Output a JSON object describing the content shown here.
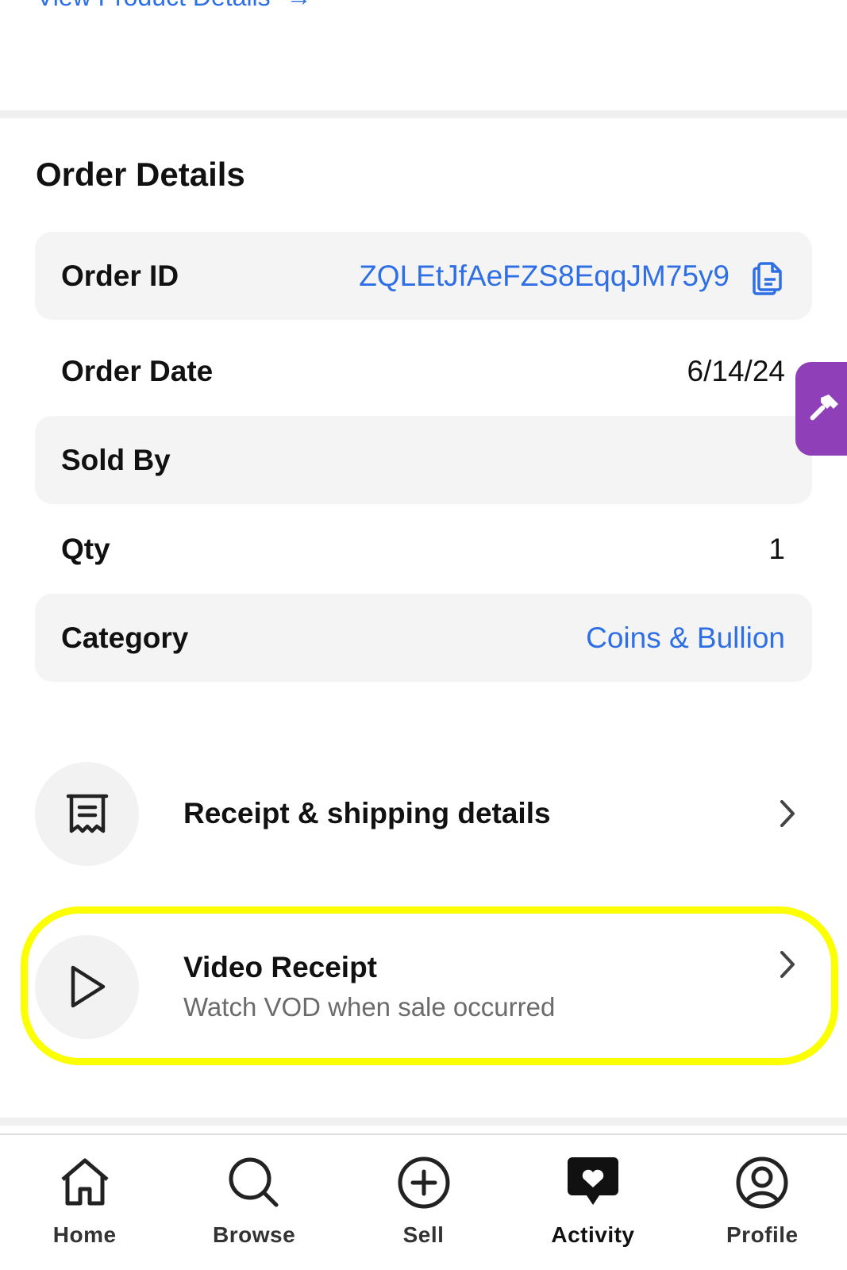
{
  "top_link": {
    "label": "View Product Details",
    "arrow": "→"
  },
  "order_details": {
    "title": "Order Details",
    "rows": [
      {
        "label": "Order ID",
        "value": "ZQLEtJfAeFZS8EqqJM75y9"
      },
      {
        "label": "Order Date",
        "value": "6/14/24"
      },
      {
        "label": "Sold By",
        "value": ""
      },
      {
        "label": "Qty",
        "value": "1"
      },
      {
        "label": "Category",
        "value": "Coins & Bullion"
      }
    ]
  },
  "actions": {
    "receipt": {
      "title": "Receipt & shipping details"
    },
    "video": {
      "title": "Video Receipt",
      "subtitle": "Watch VOD when sale occurred"
    }
  },
  "nav": {
    "items": [
      {
        "label": "Home",
        "icon": "home-icon"
      },
      {
        "label": "Browse",
        "icon": "search-icon"
      },
      {
        "label": "Sell",
        "icon": "plus-circle-icon"
      },
      {
        "label": "Activity",
        "icon": "heart-chat-icon",
        "active": true
      },
      {
        "label": "Profile",
        "icon": "user-circle-icon"
      }
    ]
  },
  "colors": {
    "link": "#2f6fe6",
    "highlight": "#fbff00",
    "side_tab": "#8f3fb8",
    "row_shade": "#f4f4f4"
  },
  "icons": {
    "copy": "copy-icon",
    "side_tab": "hammer-icon",
    "receipt": "receipt-icon",
    "video": "play-icon",
    "chevron": "chevron-right-icon"
  }
}
